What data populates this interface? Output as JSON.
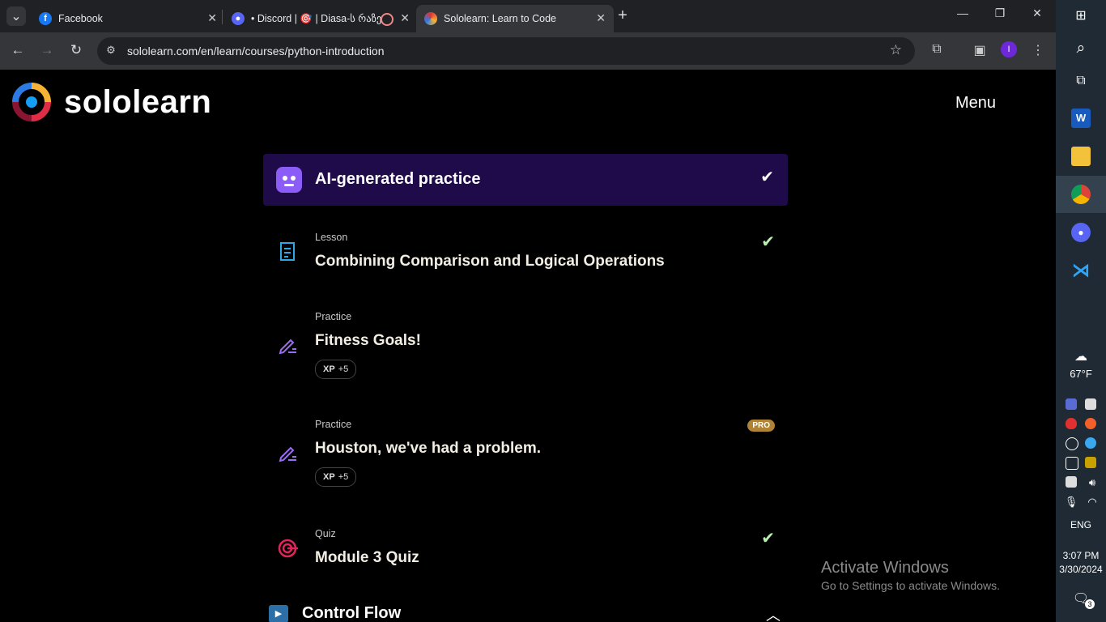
{
  "browser": {
    "tabs": [
      {
        "title": "Facebook",
        "active": false
      },
      {
        "title": "• Discord | 🎯 | Diasa-ს რაზე",
        "active": false
      },
      {
        "title": "Sololearn: Learn to Code",
        "active": true
      }
    ],
    "url": "sololearn.com/en/learn/courses/python-introduction",
    "profile_initial": "I"
  },
  "header": {
    "logo_text": "sololearn",
    "menu_label": "Menu"
  },
  "banner": {
    "title": "AI-generated practice",
    "completed": true
  },
  "items": [
    {
      "type": "Lesson",
      "title": "Combining Comparison and Logical Operations",
      "completed": true,
      "icon": "lesson-doc-icon"
    },
    {
      "type": "Practice",
      "title": "Fitness Goals!",
      "xp_label": "XP",
      "xp_value": "+5",
      "icon": "practice-pencil-icon"
    },
    {
      "type": "Practice",
      "title": "Houston, we've had a problem.",
      "xp_label": "XP",
      "xp_value": "+5",
      "pro_badge": "PRO",
      "icon": "practice-pencil-icon"
    },
    {
      "type": "Quiz",
      "title": "Module 3 Quiz",
      "completed": true,
      "icon": "quiz-target-icon"
    }
  ],
  "section": {
    "title": "Control Flow",
    "icon": "play-icon"
  },
  "watermark": {
    "line1": "Activate Windows",
    "line2": "Go to Settings to activate Windows."
  },
  "taskbar": {
    "weather_temp": "67°F",
    "language": "ENG",
    "time": "3:07 PM",
    "date": "3/30/2024",
    "notifications": "3"
  },
  "colors": {
    "banner_bg": "#1f0a4a",
    "check_green": "#b9f0b0",
    "pro_gold": "#b08236"
  }
}
